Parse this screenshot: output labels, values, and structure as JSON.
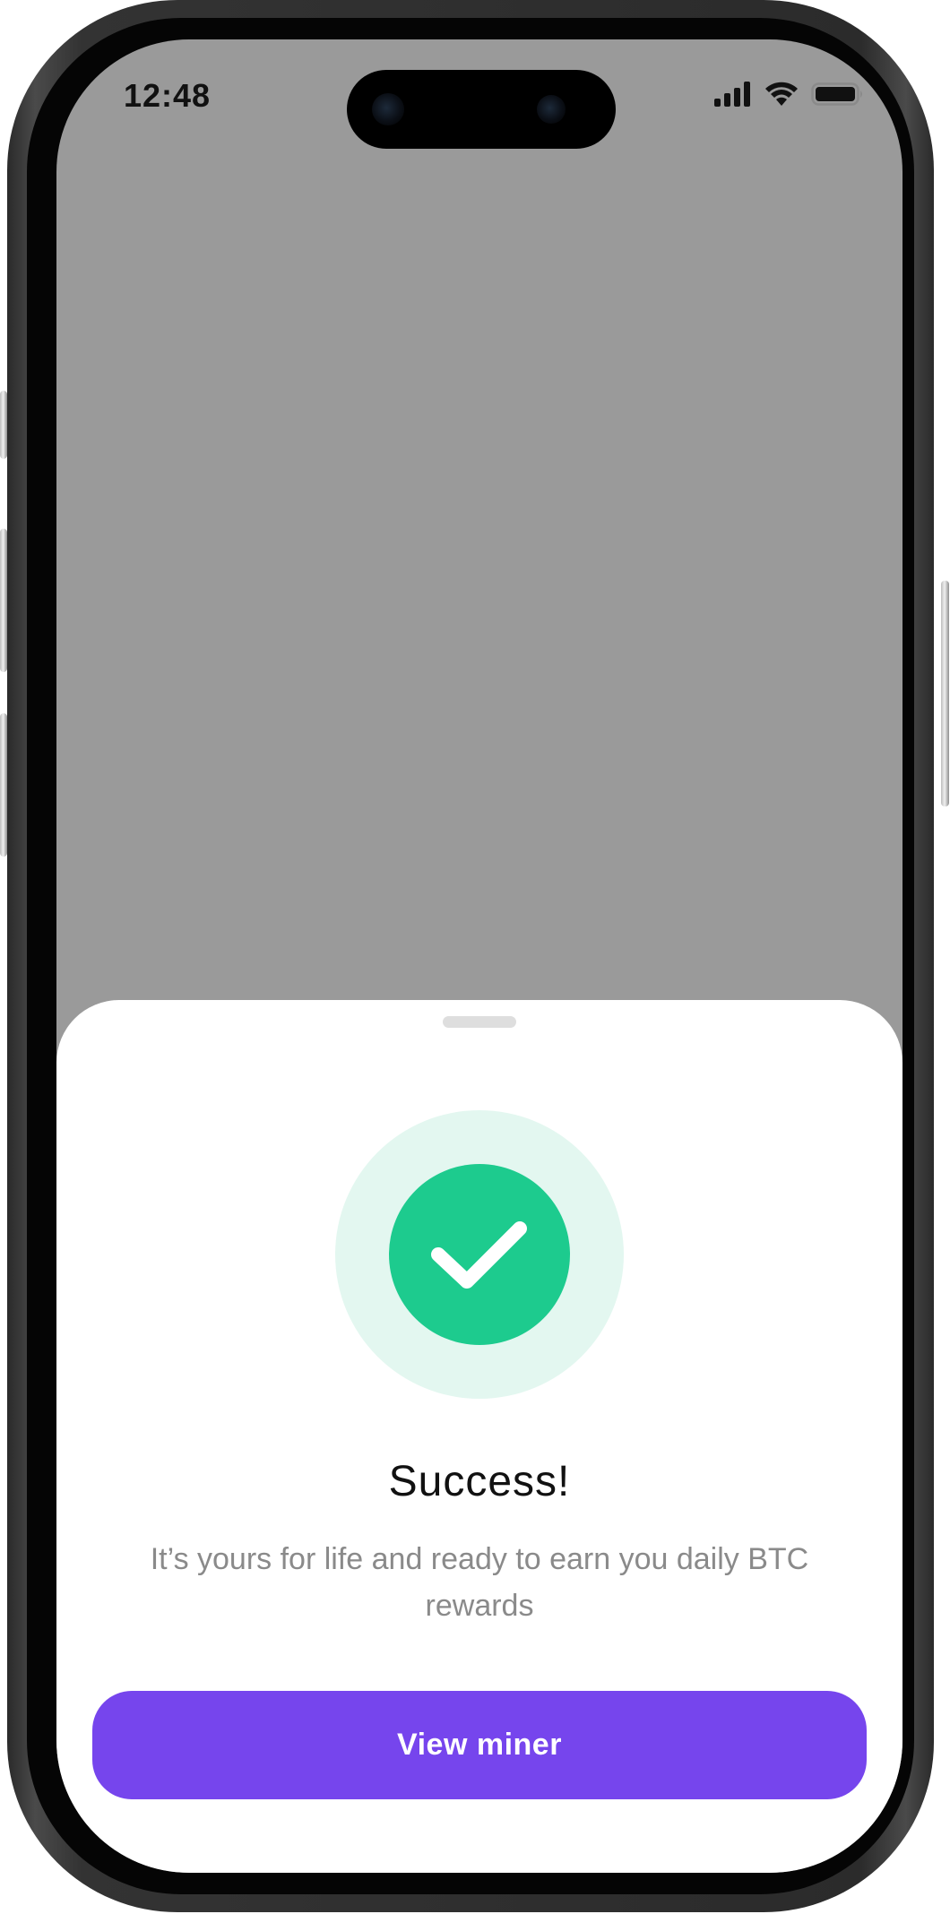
{
  "status_bar": {
    "time": "12:48",
    "icons": [
      "signal-bars-icon",
      "wifi-icon",
      "battery-icon"
    ]
  },
  "sheet": {
    "success_icon": "checkmark-icon",
    "title": "Success!",
    "message": "It’s yours for life and ready to earn you daily BTC rewards",
    "primary_button": "View miner"
  },
  "colors": {
    "accent": "#7645ED",
    "success": "#1DCB8E",
    "success_halo": "#E3F7F0",
    "backdrop": "#9A9A9A"
  }
}
